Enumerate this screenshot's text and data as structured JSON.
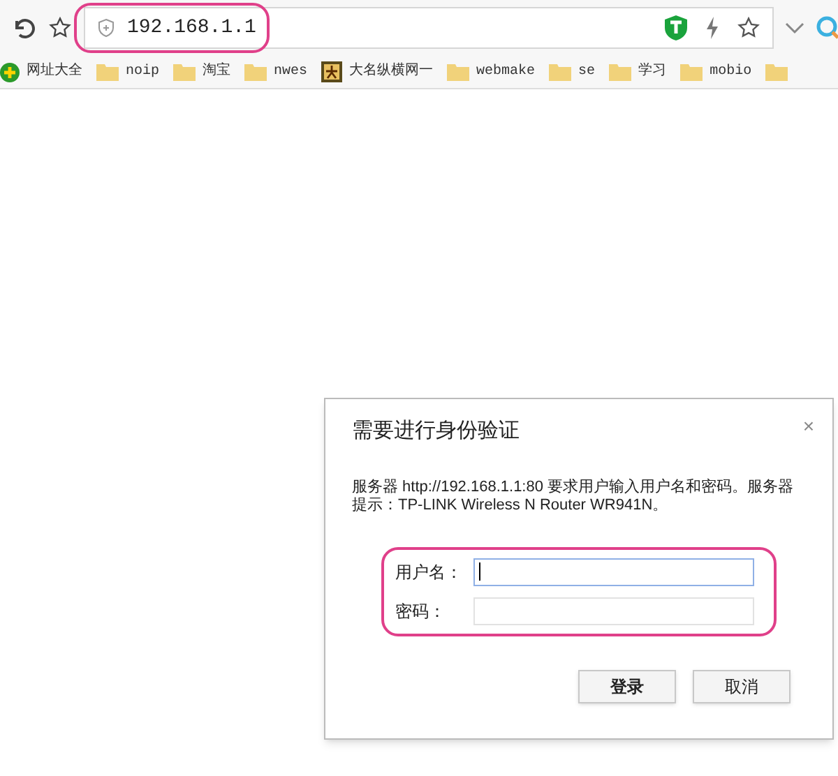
{
  "browser": {
    "address": "192.168.1.1",
    "address_highlighted": true
  },
  "bookmarks": [
    {
      "label": "网址大全",
      "kind": "site"
    },
    {
      "label": "noip",
      "kind": "folder"
    },
    {
      "label": "淘宝",
      "kind": "folder"
    },
    {
      "label": "nwes",
      "kind": "folder"
    },
    {
      "label": "大名纵横网一",
      "kind": "brand"
    },
    {
      "label": "webmake",
      "kind": "folder"
    },
    {
      "label": "se",
      "kind": "folder"
    },
    {
      "label": "学习",
      "kind": "folder"
    },
    {
      "label": "mobio",
      "kind": "folder"
    },
    {
      "kind": "folder"
    }
  ],
  "dialog": {
    "title": "需要进行身份验证",
    "close": "×",
    "message": "服务器 http://192.168.1.1:80 要求用户输入用户名和密码。服务器提示：TP-LINK Wireless N Router WR941N。",
    "fields_highlighted": true,
    "fields": [
      {
        "label": "用户名：",
        "focused": true
      },
      {
        "label": "密码：",
        "focused": false
      }
    ],
    "buttons": [
      {
        "label": "登录"
      },
      {
        "label": "取消"
      }
    ]
  }
}
